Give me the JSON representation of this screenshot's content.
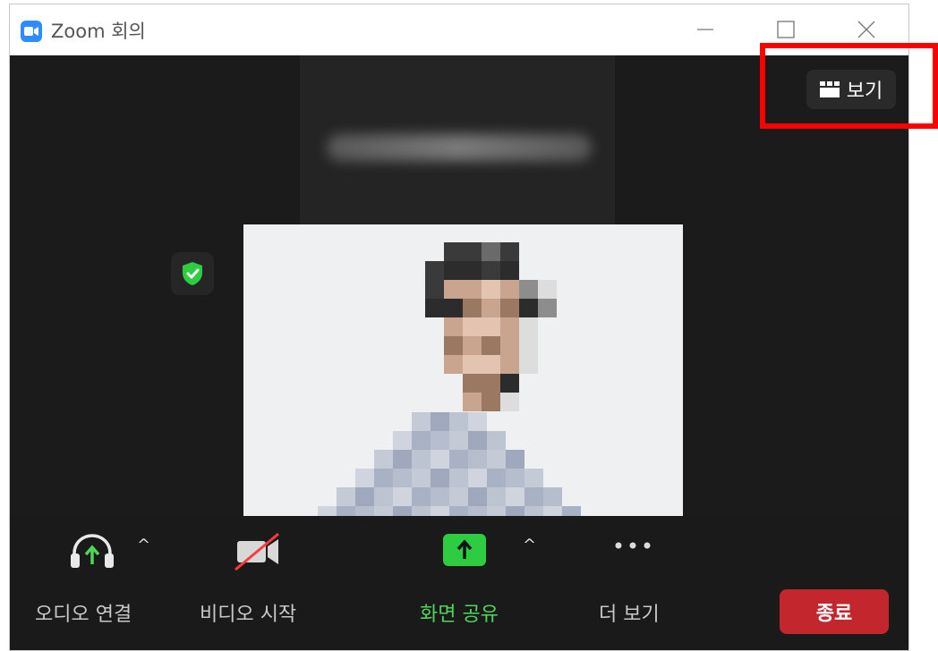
{
  "window": {
    "title": "Zoom 회의"
  },
  "top": {
    "view_label": "보기"
  },
  "toolbar": {
    "audio_label": "오디오 연결",
    "video_label": "비디오 시작",
    "share_label": "화면 공유",
    "more_label": "더 보기",
    "end_label": "종료",
    "caret": "^"
  },
  "colors": {
    "accent_green": "#4fd55a",
    "end_red": "#c4262d",
    "zoom_blue": "#2d8cff",
    "highlight_red": "#ff0000"
  }
}
